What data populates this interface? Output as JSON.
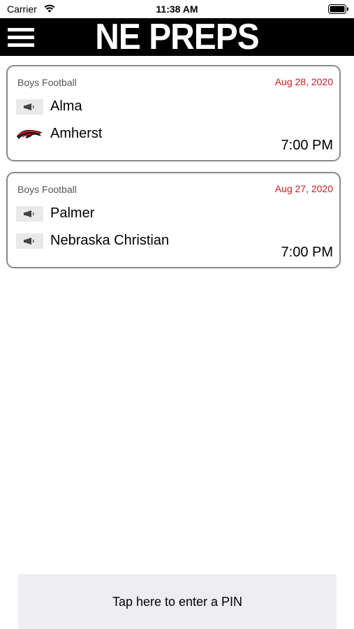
{
  "status_bar": {
    "carrier": "Carrier",
    "time": "11:38 AM"
  },
  "header": {
    "brand": "NE PREPS",
    "menu_icon": "hamburger-menu-icon",
    "background": "#000000"
  },
  "games": [
    {
      "sport": "Boys Football",
      "date": "Aug 28, 2020",
      "teams": [
        {
          "name": "Alma",
          "logo": "megaphone-icon"
        },
        {
          "name": "Amherst",
          "logo": "broncos-logo-icon"
        }
      ],
      "time": "7:00 PM"
    },
    {
      "sport": "Boys Football",
      "date": "Aug 27, 2020",
      "teams": [
        {
          "name": "Palmer",
          "logo": "megaphone-icon"
        },
        {
          "name": "Nebraska Christian",
          "logo": "megaphone-icon"
        }
      ],
      "time": "7:00 PM"
    }
  ],
  "pin_bar": {
    "label": "Tap here to enter a PIN"
  },
  "colors": {
    "date_red": "#d0171d",
    "card_border": "#8a8a8a",
    "pin_bar_bg": "#eeeef2"
  }
}
